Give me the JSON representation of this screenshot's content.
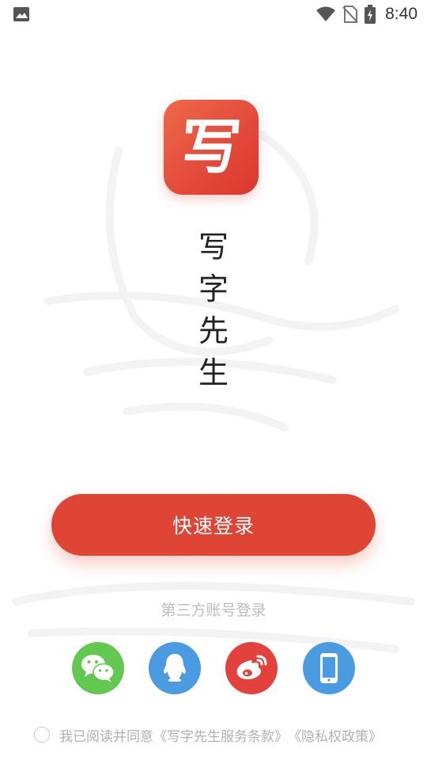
{
  "status_bar": {
    "time": "8:40",
    "icons": [
      "image-icon",
      "wifi-icon",
      "no-sim-icon",
      "battery-charging-icon"
    ]
  },
  "logo": {
    "char": "写",
    "icon": "app-logo-icon",
    "color": "#e2483a"
  },
  "app_title": {
    "chars": [
      "写",
      "字",
      "先",
      "生"
    ]
  },
  "login": {
    "quick_label": "快速登录",
    "button_color": "#de4534"
  },
  "third_party": {
    "label": "第三方账号登录",
    "options": [
      {
        "name": "wechat",
        "icon": "wechat-icon",
        "color": "#63c84f"
      },
      {
        "name": "qq",
        "icon": "qq-icon",
        "color": "#4a9bdf"
      },
      {
        "name": "weibo",
        "icon": "weibo-icon",
        "color": "#e3423c"
      },
      {
        "name": "phone",
        "icon": "phone-icon",
        "color": "#4a9bdf"
      }
    ]
  },
  "agreement": {
    "prefix": "我已阅读并同意",
    "terms": "《写字先生服务条款》",
    "privacy": "《隐私权政策》",
    "checked": false
  }
}
